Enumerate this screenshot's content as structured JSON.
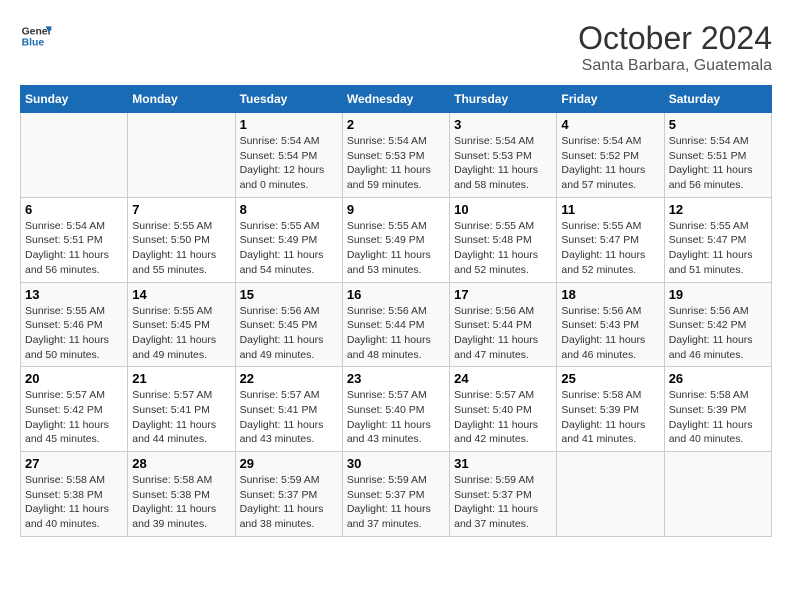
{
  "header": {
    "logo_line1": "General",
    "logo_line2": "Blue",
    "month": "October 2024",
    "location": "Santa Barbara, Guatemala"
  },
  "days_of_week": [
    "Sunday",
    "Monday",
    "Tuesday",
    "Wednesday",
    "Thursday",
    "Friday",
    "Saturday"
  ],
  "weeks": [
    [
      {
        "day": "",
        "info": ""
      },
      {
        "day": "",
        "info": ""
      },
      {
        "day": "1",
        "info": "Sunrise: 5:54 AM\nSunset: 5:54 PM\nDaylight: 12 hours\nand 0 minutes."
      },
      {
        "day": "2",
        "info": "Sunrise: 5:54 AM\nSunset: 5:53 PM\nDaylight: 11 hours\nand 59 minutes."
      },
      {
        "day": "3",
        "info": "Sunrise: 5:54 AM\nSunset: 5:53 PM\nDaylight: 11 hours\nand 58 minutes."
      },
      {
        "day": "4",
        "info": "Sunrise: 5:54 AM\nSunset: 5:52 PM\nDaylight: 11 hours\nand 57 minutes."
      },
      {
        "day": "5",
        "info": "Sunrise: 5:54 AM\nSunset: 5:51 PM\nDaylight: 11 hours\nand 56 minutes."
      }
    ],
    [
      {
        "day": "6",
        "info": "Sunrise: 5:54 AM\nSunset: 5:51 PM\nDaylight: 11 hours\nand 56 minutes."
      },
      {
        "day": "7",
        "info": "Sunrise: 5:55 AM\nSunset: 5:50 PM\nDaylight: 11 hours\nand 55 minutes."
      },
      {
        "day": "8",
        "info": "Sunrise: 5:55 AM\nSunset: 5:49 PM\nDaylight: 11 hours\nand 54 minutes."
      },
      {
        "day": "9",
        "info": "Sunrise: 5:55 AM\nSunset: 5:49 PM\nDaylight: 11 hours\nand 53 minutes."
      },
      {
        "day": "10",
        "info": "Sunrise: 5:55 AM\nSunset: 5:48 PM\nDaylight: 11 hours\nand 52 minutes."
      },
      {
        "day": "11",
        "info": "Sunrise: 5:55 AM\nSunset: 5:47 PM\nDaylight: 11 hours\nand 52 minutes."
      },
      {
        "day": "12",
        "info": "Sunrise: 5:55 AM\nSunset: 5:47 PM\nDaylight: 11 hours\nand 51 minutes."
      }
    ],
    [
      {
        "day": "13",
        "info": "Sunrise: 5:55 AM\nSunset: 5:46 PM\nDaylight: 11 hours\nand 50 minutes."
      },
      {
        "day": "14",
        "info": "Sunrise: 5:55 AM\nSunset: 5:45 PM\nDaylight: 11 hours\nand 49 minutes."
      },
      {
        "day": "15",
        "info": "Sunrise: 5:56 AM\nSunset: 5:45 PM\nDaylight: 11 hours\nand 49 minutes."
      },
      {
        "day": "16",
        "info": "Sunrise: 5:56 AM\nSunset: 5:44 PM\nDaylight: 11 hours\nand 48 minutes."
      },
      {
        "day": "17",
        "info": "Sunrise: 5:56 AM\nSunset: 5:44 PM\nDaylight: 11 hours\nand 47 minutes."
      },
      {
        "day": "18",
        "info": "Sunrise: 5:56 AM\nSunset: 5:43 PM\nDaylight: 11 hours\nand 46 minutes."
      },
      {
        "day": "19",
        "info": "Sunrise: 5:56 AM\nSunset: 5:42 PM\nDaylight: 11 hours\nand 46 minutes."
      }
    ],
    [
      {
        "day": "20",
        "info": "Sunrise: 5:57 AM\nSunset: 5:42 PM\nDaylight: 11 hours\nand 45 minutes."
      },
      {
        "day": "21",
        "info": "Sunrise: 5:57 AM\nSunset: 5:41 PM\nDaylight: 11 hours\nand 44 minutes."
      },
      {
        "day": "22",
        "info": "Sunrise: 5:57 AM\nSunset: 5:41 PM\nDaylight: 11 hours\nand 43 minutes."
      },
      {
        "day": "23",
        "info": "Sunrise: 5:57 AM\nSunset: 5:40 PM\nDaylight: 11 hours\nand 43 minutes."
      },
      {
        "day": "24",
        "info": "Sunrise: 5:57 AM\nSunset: 5:40 PM\nDaylight: 11 hours\nand 42 minutes."
      },
      {
        "day": "25",
        "info": "Sunrise: 5:58 AM\nSunset: 5:39 PM\nDaylight: 11 hours\nand 41 minutes."
      },
      {
        "day": "26",
        "info": "Sunrise: 5:58 AM\nSunset: 5:39 PM\nDaylight: 11 hours\nand 40 minutes."
      }
    ],
    [
      {
        "day": "27",
        "info": "Sunrise: 5:58 AM\nSunset: 5:38 PM\nDaylight: 11 hours\nand 40 minutes."
      },
      {
        "day": "28",
        "info": "Sunrise: 5:58 AM\nSunset: 5:38 PM\nDaylight: 11 hours\nand 39 minutes."
      },
      {
        "day": "29",
        "info": "Sunrise: 5:59 AM\nSunset: 5:37 PM\nDaylight: 11 hours\nand 38 minutes."
      },
      {
        "day": "30",
        "info": "Sunrise: 5:59 AM\nSunset: 5:37 PM\nDaylight: 11 hours\nand 37 minutes."
      },
      {
        "day": "31",
        "info": "Sunrise: 5:59 AM\nSunset: 5:37 PM\nDaylight: 11 hours\nand 37 minutes."
      },
      {
        "day": "",
        "info": ""
      },
      {
        "day": "",
        "info": ""
      }
    ]
  ]
}
